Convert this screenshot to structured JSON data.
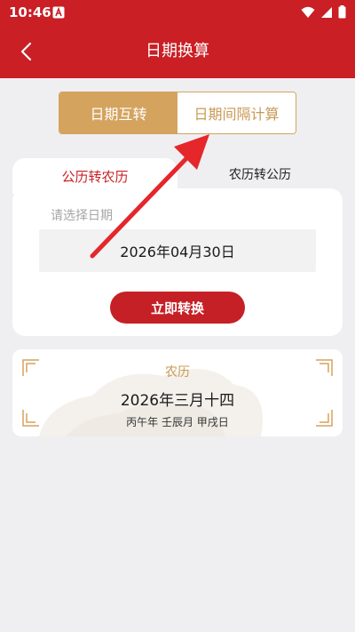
{
  "status_bar": {
    "time": "10:46"
  },
  "nav": {
    "title": "日期换算"
  },
  "mode_tabs": [
    {
      "label": "日期互转",
      "active": true
    },
    {
      "label": "日期间隔计算",
      "active": false
    }
  ],
  "convert_tabs": [
    {
      "label": "公历转农历",
      "active": true
    },
    {
      "label": "农历转公历",
      "active": false
    }
  ],
  "date_input": {
    "label": "请选择日期",
    "value": "2026年04月30日"
  },
  "convert_button": "立即转换",
  "result": {
    "title": "农历",
    "date": "2026年三月十四",
    "ganzhi": "丙午年 壬辰月 甲戌日"
  },
  "colors": {
    "header_red": "#c91f25",
    "gold": "#d4a35e",
    "annotation_arrow": "#e5262b"
  }
}
